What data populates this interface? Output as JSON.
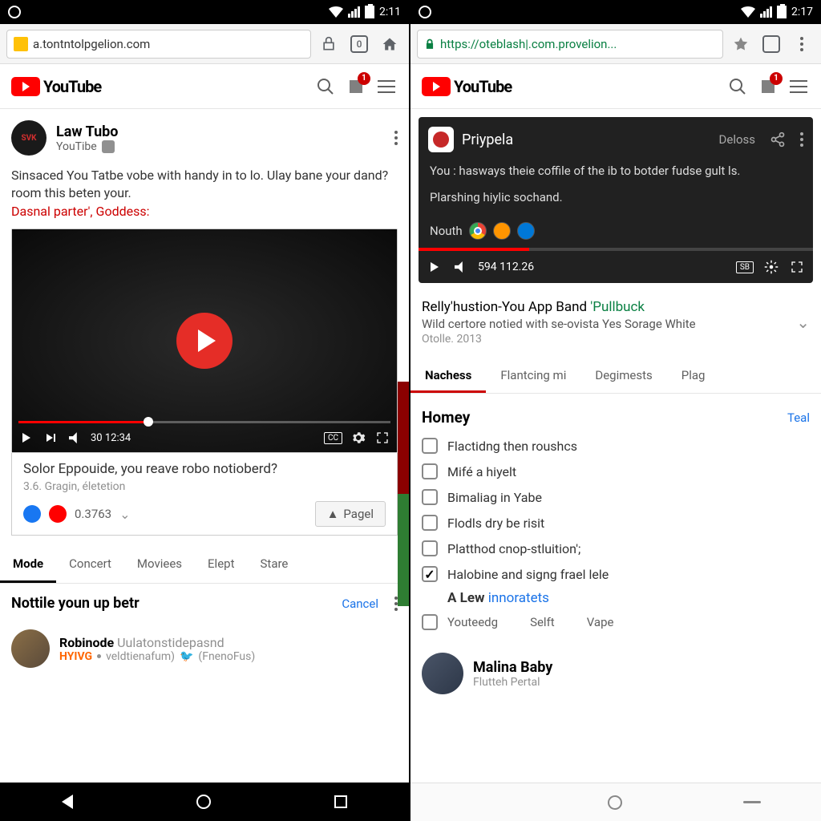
{
  "left": {
    "status": {
      "time": "2:11"
    },
    "url": "a.tontntolpgelion.com",
    "tabs_count": "0",
    "yt_brand": "YouTube",
    "notif_badge": "1",
    "post": {
      "channel": "Law Tubo",
      "subtitle": "YouTibe",
      "text": "Sinsaced You Tatbe vobe with handy in to lo. Ulay bane your dand? room this beten your.",
      "link": "Dasnal parter', Goddess:"
    },
    "player": {
      "time": "30 12:34",
      "cc": "CC"
    },
    "video": {
      "title": "Solor Eppouide, you reave robo notioberd?",
      "meta": "3.6. Gragin, életetion",
      "rating": "0.3763",
      "page_btn": "Pagel"
    },
    "tabs": [
      "Mode",
      "Concert",
      "Moviees",
      "Elept",
      "Stare"
    ],
    "section": {
      "title": "Nottile youn up betr",
      "action": "Cancel"
    },
    "user": {
      "name_bold": "Robinode",
      "name_gray": "Uulatonstidepasnd",
      "tag": "HYIVG",
      "handle1": "veldtienafum)",
      "handle2": "(FnenoFus)"
    }
  },
  "right": {
    "status": {
      "time": "2:17"
    },
    "url": "https://oteblash|.com.provelion...",
    "yt_brand": "YouTube",
    "notif_badge": "1",
    "dark": {
      "title": "Priypela",
      "action": "Deloss",
      "body1": "You : hasways theie coffile of the ib to botder fudse gult ls.",
      "body2": "Plarshing hiylic sochand.",
      "icons_label": "Nouth",
      "time": "594 112.26",
      "cc": "SB"
    },
    "result": {
      "title_prefix": "Relly'hustion-You",
      "title_mid": " App Band ",
      "title_suffix": "'Pullbuck",
      "desc": "Wild certore notied with se-ovista Yes Sorage White",
      "meta": "Otolle. 2013"
    },
    "tabs": [
      "Nachess",
      "Flantcing mi",
      "Degimests",
      "Plag"
    ],
    "list": {
      "title": "Homey",
      "action": "Teal",
      "items": [
        {
          "label": "Flactidng then roushcs",
          "checked": false
        },
        {
          "label": "Mifé a hiyelt",
          "checked": false
        },
        {
          "label": "Bimaliag in Yabe",
          "checked": false
        },
        {
          "label": "Flodls dry be risit",
          "checked": false
        },
        {
          "label": "Platthod cnop-stluition';",
          "checked": false
        },
        {
          "label": "Halobine and signg frael lele",
          "checked": true
        }
      ],
      "alew_bold": "A Lew",
      "alew_link": "innoratets",
      "sub_items": [
        "Youteedg",
        "Selft",
        "Vape"
      ]
    },
    "bottom_user": {
      "name": "Malina Baby",
      "sub": "Flutteh Pertal"
    }
  }
}
